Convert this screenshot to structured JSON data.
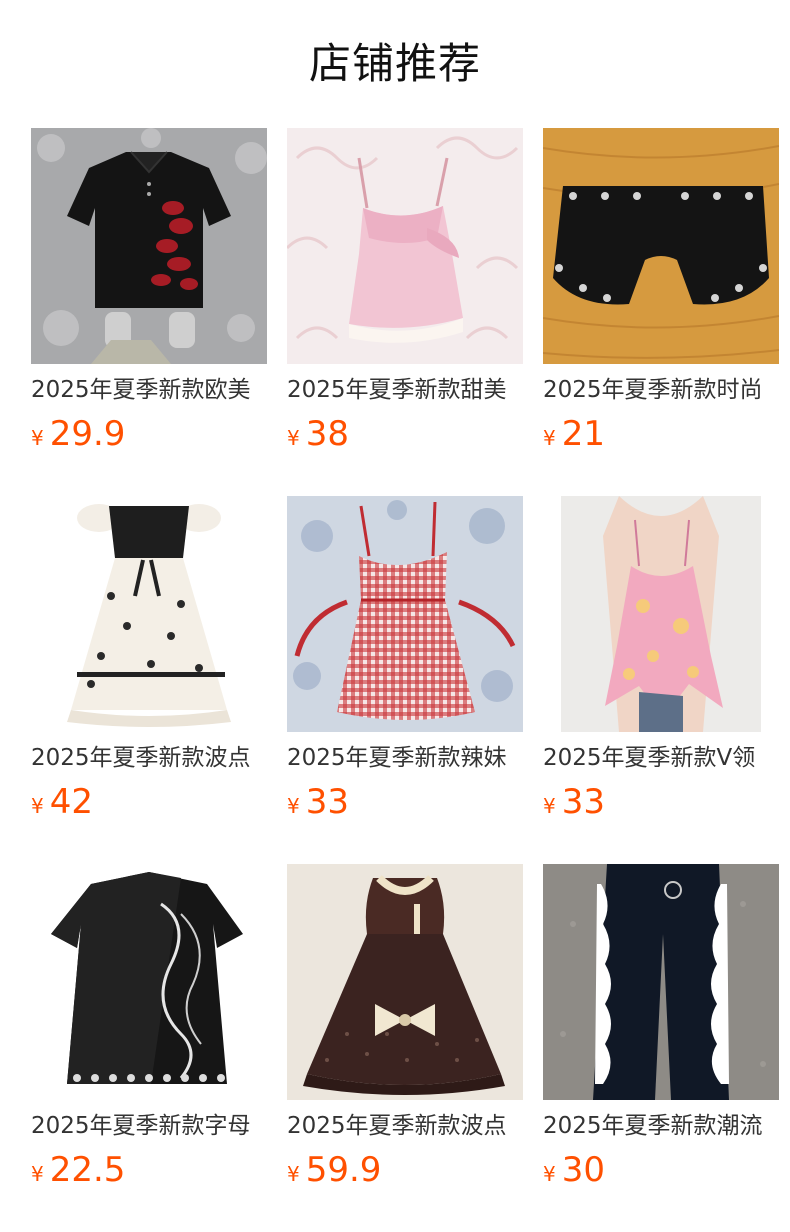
{
  "page": {
    "title": "店铺推荐"
  },
  "theme": {
    "price_color": "#ff5000",
    "text_color": "#333333"
  },
  "products": [
    {
      "name": "2025年夏季新款欧美",
      "currency": "¥",
      "price": "29.9",
      "image": "black-polo-shirt-red-lips"
    },
    {
      "name": "2025年夏季新款甜美",
      "currency": "¥",
      "price": "38",
      "image": "pink-satin-cami-top"
    },
    {
      "name": "2025年夏季新款时尚",
      "currency": "¥",
      "price": "21",
      "image": "black-grommet-shorts"
    },
    {
      "name": "2025年夏季新款波点",
      "currency": "¥",
      "price": "42",
      "image": "polka-dot-dress"
    },
    {
      "name": "2025年夏季新款辣妹",
      "currency": "¥",
      "price": "33",
      "image": "red-gingham-cami-dress"
    },
    {
      "name": "2025年夏季新款V领",
      "currency": "¥",
      "price": "33",
      "image": "pink-floral-cami-top"
    },
    {
      "name": "2025年夏季新款字母",
      "currency": "¥",
      "price": "22.5",
      "image": "black-letter-print-tee"
    },
    {
      "name": "2025年夏季新款波点",
      "currency": "¥",
      "price": "59.9",
      "image": "brown-polka-dot-bow-dress"
    },
    {
      "name": "2025年夏季新款潮流",
      "currency": "¥",
      "price": "30",
      "image": "black-flare-pants-cow-print"
    }
  ]
}
